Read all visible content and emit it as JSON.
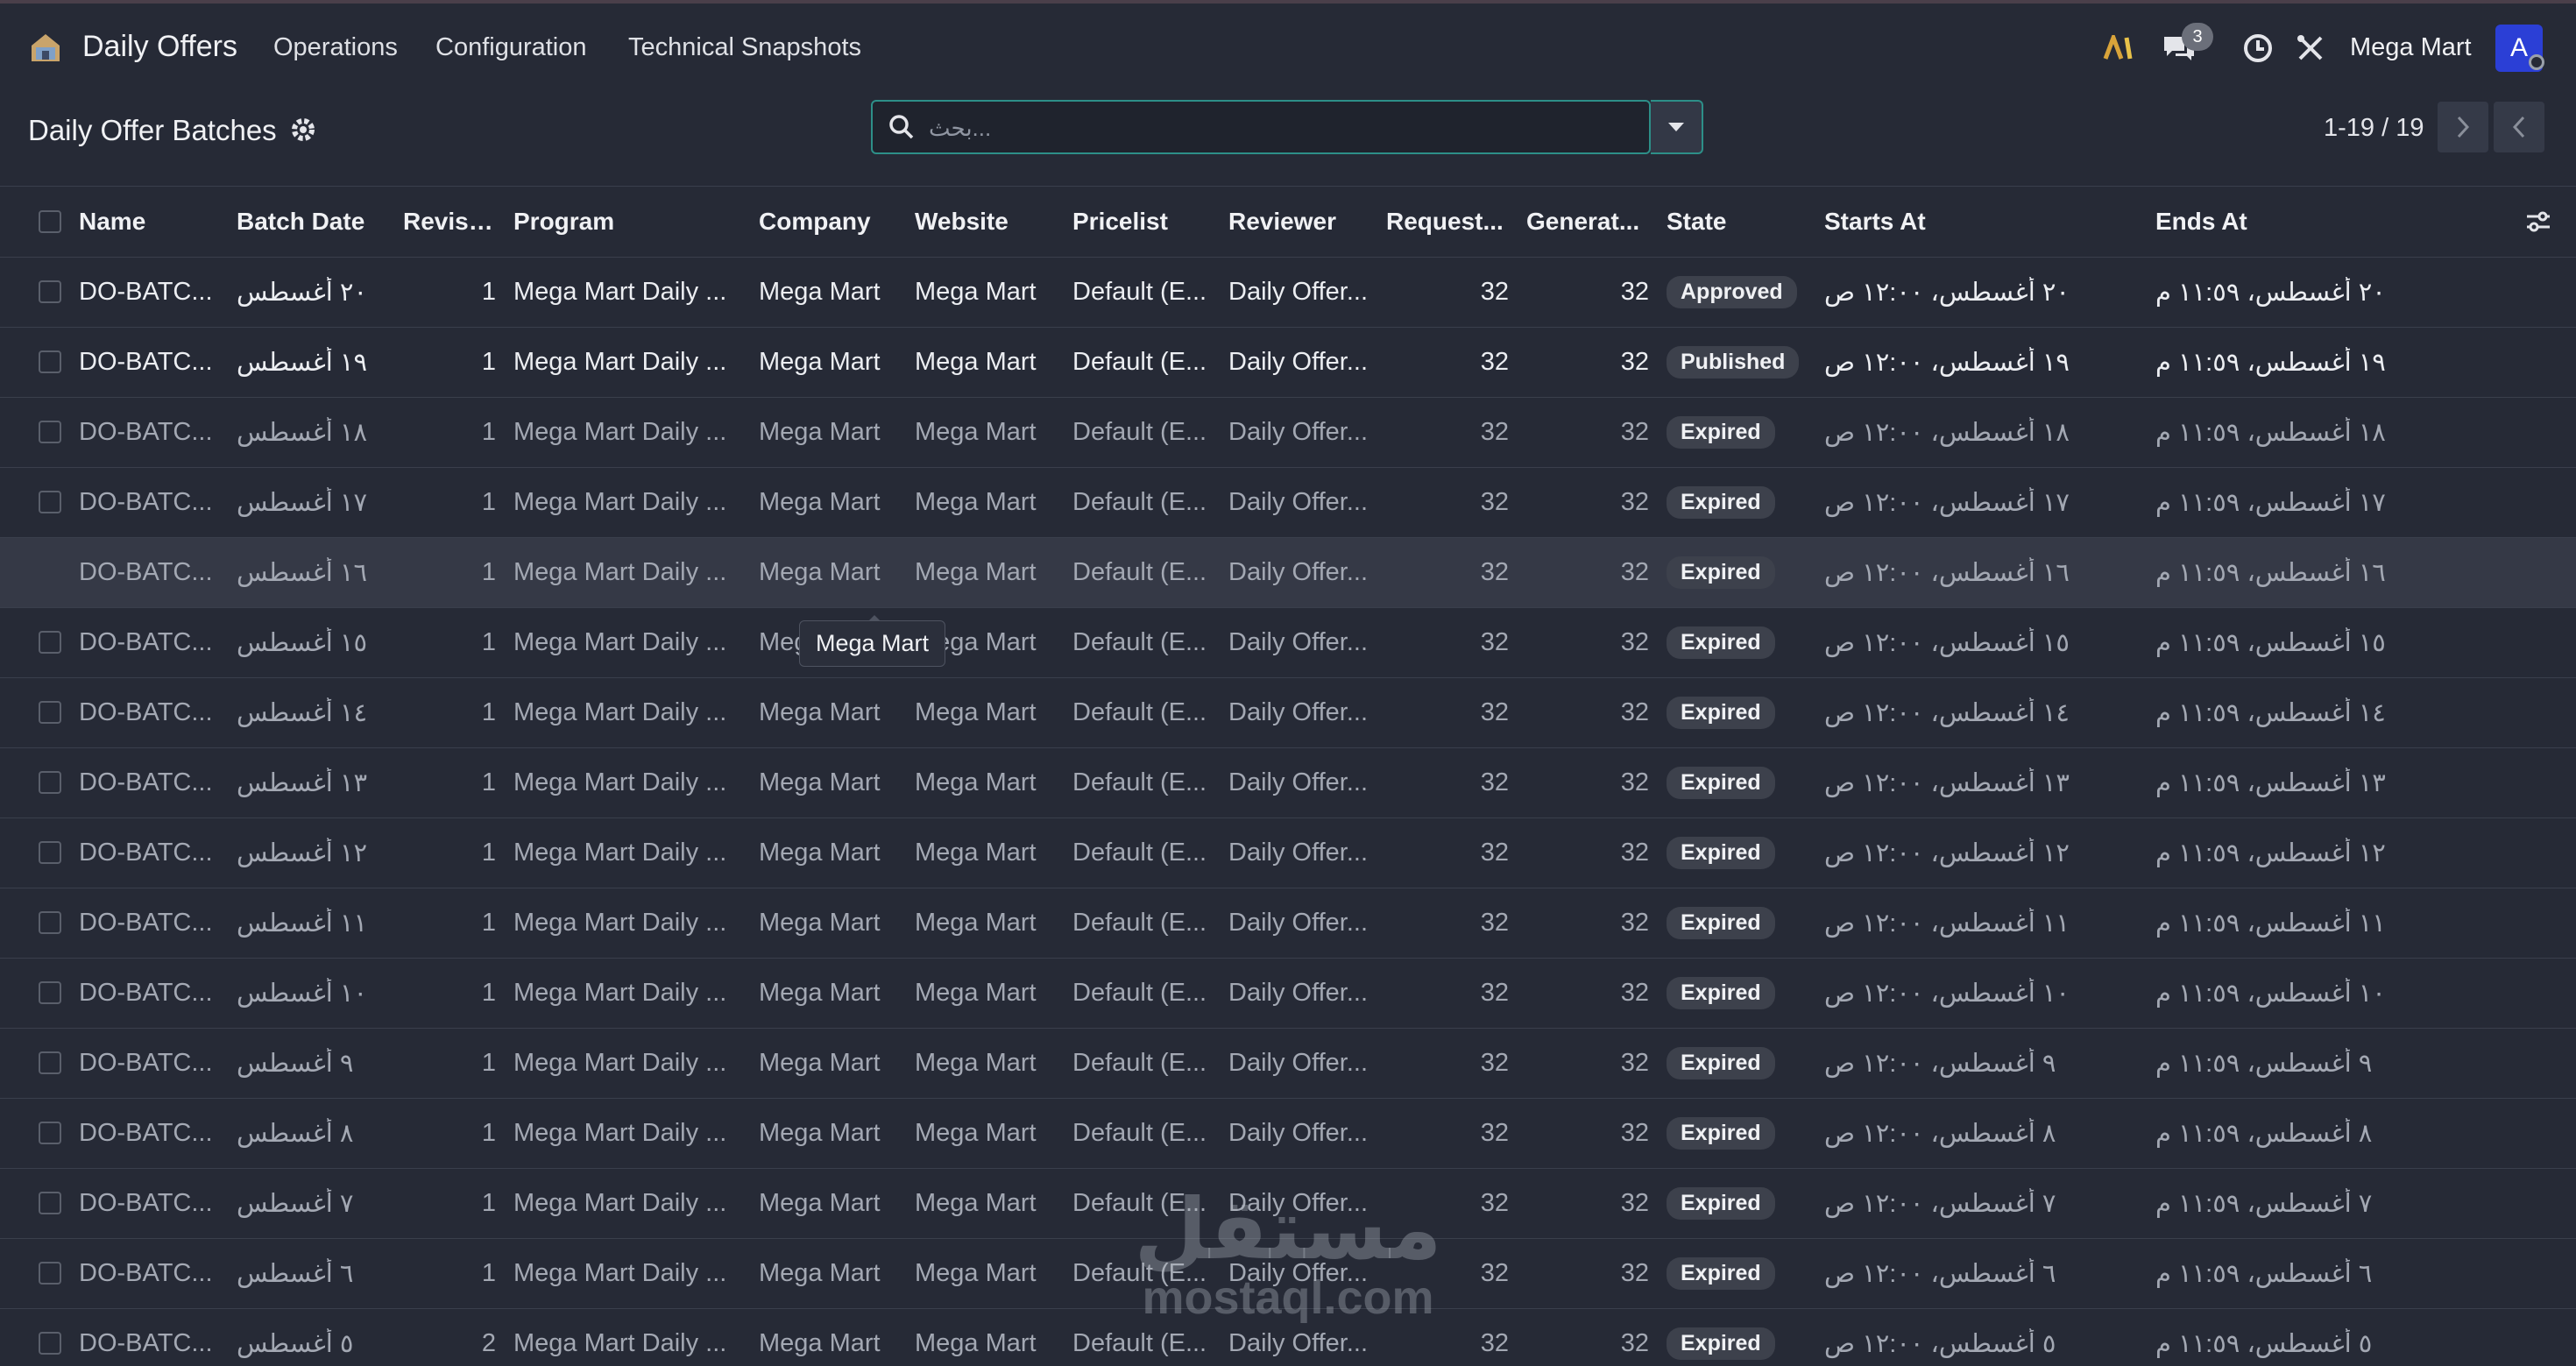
{
  "app": {
    "title": "Daily Offers",
    "menu": [
      "Operations",
      "Configuration",
      "Technical Snapshots"
    ],
    "messages_count": "3",
    "company": "Mega Mart",
    "avatar_letter": "A",
    "icons": [
      "app-home-icon",
      "ai-icon",
      "chat-icon",
      "clock-icon",
      "tools-icon"
    ]
  },
  "control_panel": {
    "title": "Daily Offer Batches",
    "search_placeholder": "...بحث",
    "pager_value": "1-19 / 19"
  },
  "table": {
    "columns": [
      "Name",
      "Batch Date",
      "Revision",
      "Program",
      "Company",
      "Website",
      "Pricelist",
      "Reviewer",
      "Request...",
      "Generat...",
      "State",
      "Starts At",
      "Ends At"
    ],
    "rows": [
      {
        "name": "DO-BATC...",
        "batch_date": "٢٠ أغسطس",
        "revision": "1",
        "program": "Mega Mart Daily ...",
        "company": "Mega Mart",
        "website": "Mega Mart",
        "pricelist": "Default (E...",
        "reviewer": "Daily Offer...",
        "requested": "32",
        "generated": "32",
        "state": "Approved",
        "starts_at": "٢٠ أغسطس، ١٢:٠٠ ص",
        "ends_at": "٢٠ أغسطس، ١١:٥٩ م",
        "muted": false
      },
      {
        "name": "DO-BATC...",
        "batch_date": "١٩ أغسطس",
        "revision": "1",
        "program": "Mega Mart Daily ...",
        "company": "Mega Mart",
        "website": "Mega Mart",
        "pricelist": "Default (E...",
        "reviewer": "Daily Offer...",
        "requested": "32",
        "generated": "32",
        "state": "Published",
        "starts_at": "١٩ أغسطس، ١٢:٠٠ ص",
        "ends_at": "١٩ أغسطس، ١١:٥٩ م",
        "muted": false
      },
      {
        "name": "DO-BATC...",
        "batch_date": "١٨ أغسطس",
        "revision": "1",
        "program": "Mega Mart Daily ...",
        "company": "Mega Mart",
        "website": "Mega Mart",
        "pricelist": "Default (E...",
        "reviewer": "Daily Offer...",
        "requested": "32",
        "generated": "32",
        "state": "Expired",
        "starts_at": "١٨ أغسطس، ١٢:٠٠ ص",
        "ends_at": "١٨ أغسطس، ١١:٥٩ م",
        "muted": true
      },
      {
        "name": "DO-BATC...",
        "batch_date": "١٧ أغسطس",
        "revision": "1",
        "program": "Mega Mart Daily ...",
        "company": "Mega Mart",
        "website": "Mega Mart",
        "pricelist": "Default (E...",
        "reviewer": "Daily Offer...",
        "requested": "32",
        "generated": "32",
        "state": "Expired",
        "starts_at": "١٧ أغسطس، ١٢:٠٠ ص",
        "ends_at": "١٧ أغسطس، ١١:٥٩ م",
        "muted": true
      },
      {
        "name": "DO-BATC...",
        "batch_date": "١٦ أغسطس",
        "revision": "1",
        "program": "Mega Mart Daily ...",
        "company": "Mega Mart",
        "website": "Mega Mart",
        "pricelist": "Default (E...",
        "reviewer": "Daily Offer...",
        "requested": "32",
        "generated": "32",
        "state": "Expired",
        "starts_at": "١٦ أغسطس، ١٢:٠٠ ص",
        "ends_at": "١٦ أغسطس، ١١:٥٩ م",
        "muted": true,
        "hover": true
      },
      {
        "name": "DO-BATC...",
        "batch_date": "١٥ أغسطس",
        "revision": "1",
        "program": "Mega Mart Daily ...",
        "company": "Mega Mart",
        "website": "Mega Mart",
        "pricelist": "Default (E...",
        "reviewer": "Daily Offer...",
        "requested": "32",
        "generated": "32",
        "state": "Expired",
        "starts_at": "١٥ أغسطس، ١٢:٠٠ ص",
        "ends_at": "١٥ أغسطس، ١١:٥٩ م",
        "muted": true
      },
      {
        "name": "DO-BATC...",
        "batch_date": "١٤ أغسطس",
        "revision": "1",
        "program": "Mega Mart Daily ...",
        "company": "Mega Mart",
        "website": "Mega Mart",
        "pricelist": "Default (E...",
        "reviewer": "Daily Offer...",
        "requested": "32",
        "generated": "32",
        "state": "Expired",
        "starts_at": "١٤ أغسطس، ١٢:٠٠ ص",
        "ends_at": "١٤ أغسطس، ١١:٥٩ م",
        "muted": true
      },
      {
        "name": "DO-BATC...",
        "batch_date": "١٣ أغسطس",
        "revision": "1",
        "program": "Mega Mart Daily ...",
        "company": "Mega Mart",
        "website": "Mega Mart",
        "pricelist": "Default (E...",
        "reviewer": "Daily Offer...",
        "requested": "32",
        "generated": "32",
        "state": "Expired",
        "starts_at": "١٣ أغسطس، ١٢:٠٠ ص",
        "ends_at": "١٣ أغسطس، ١١:٥٩ م",
        "muted": true
      },
      {
        "name": "DO-BATC...",
        "batch_date": "١٢ أغسطس",
        "revision": "1",
        "program": "Mega Mart Daily ...",
        "company": "Mega Mart",
        "website": "Mega Mart",
        "pricelist": "Default (E...",
        "reviewer": "Daily Offer...",
        "requested": "32",
        "generated": "32",
        "state": "Expired",
        "starts_at": "١٢ أغسطس، ١٢:٠٠ ص",
        "ends_at": "١٢ أغسطس، ١١:٥٩ م",
        "muted": true
      },
      {
        "name": "DO-BATC...",
        "batch_date": "١١ أغسطس",
        "revision": "1",
        "program": "Mega Mart Daily ...",
        "company": "Mega Mart",
        "website": "Mega Mart",
        "pricelist": "Default (E...",
        "reviewer": "Daily Offer...",
        "requested": "32",
        "generated": "32",
        "state": "Expired",
        "starts_at": "١١ أغسطس، ١٢:٠٠ ص",
        "ends_at": "١١ أغسطس، ١١:٥٩ م",
        "muted": true
      },
      {
        "name": "DO-BATC...",
        "batch_date": "١٠ أغسطس",
        "revision": "1",
        "program": "Mega Mart Daily ...",
        "company": "Mega Mart",
        "website": "Mega Mart",
        "pricelist": "Default (E...",
        "reviewer": "Daily Offer...",
        "requested": "32",
        "generated": "32",
        "state": "Expired",
        "starts_at": "١٠ أغسطس، ١٢:٠٠ ص",
        "ends_at": "١٠ أغسطس، ١١:٥٩ م",
        "muted": true
      },
      {
        "name": "DO-BATC...",
        "batch_date": "٩ أغسطس",
        "revision": "1",
        "program": "Mega Mart Daily ...",
        "company": "Mega Mart",
        "website": "Mega Mart",
        "pricelist": "Default (E...",
        "reviewer": "Daily Offer...",
        "requested": "32",
        "generated": "32",
        "state": "Expired",
        "starts_at": "٩ أغسطس، ١٢:٠٠ ص",
        "ends_at": "٩ أغسطس، ١١:٥٩ م",
        "muted": true
      },
      {
        "name": "DO-BATC...",
        "batch_date": "٨ أغسطس",
        "revision": "1",
        "program": "Mega Mart Daily ...",
        "company": "Mega Mart",
        "website": "Mega Mart",
        "pricelist": "Default (E...",
        "reviewer": "Daily Offer...",
        "requested": "32",
        "generated": "32",
        "state": "Expired",
        "starts_at": "٨ أغسطس، ١٢:٠٠ ص",
        "ends_at": "٨ أغسطس، ١١:٥٩ م",
        "muted": true
      },
      {
        "name": "DO-BATC...",
        "batch_date": "٧ أغسطس",
        "revision": "1",
        "program": "Mega Mart Daily ...",
        "company": "Mega Mart",
        "website": "Mega Mart",
        "pricelist": "Default (E...",
        "reviewer": "Daily Offer...",
        "requested": "32",
        "generated": "32",
        "state": "Expired",
        "starts_at": "٧ أغسطس، ١٢:٠٠ ص",
        "ends_at": "٧ أغسطس، ١١:٥٩ م",
        "muted": true
      },
      {
        "name": "DO-BATC...",
        "batch_date": "٦ أغسطس",
        "revision": "1",
        "program": "Mega Mart Daily ...",
        "company": "Mega Mart",
        "website": "Mega Mart",
        "pricelist": "Default (E...",
        "reviewer": "Daily Offer...",
        "requested": "32",
        "generated": "32",
        "state": "Expired",
        "starts_at": "٦ أغسطس، ١٢:٠٠ ص",
        "ends_at": "٦ أغسطس، ١١:٥٩ م",
        "muted": true
      },
      {
        "name": "DO-BATC...",
        "batch_date": "٥ أغسطس",
        "revision": "2",
        "program": "Mega Mart Daily ...",
        "company": "Mega Mart",
        "website": "Mega Mart",
        "pricelist": "Default (E...",
        "reviewer": "Daily Offer...",
        "requested": "32",
        "generated": "32",
        "state": "Expired",
        "starts_at": "٥ أغسطس، ١٢:٠٠ ص",
        "ends_at": "٥ أغسطس، ١١:٥٩ م",
        "muted": true
      }
    ]
  },
  "tooltip": {
    "text": "Mega Mart"
  },
  "watermark": {
    "arabic": "مستقل",
    "latin": "mostaql.com"
  },
  "colors": {
    "background": "#262a36",
    "accent": "#2d8f88",
    "avatar": "#2b3fd6",
    "badge": "#3d414c"
  }
}
